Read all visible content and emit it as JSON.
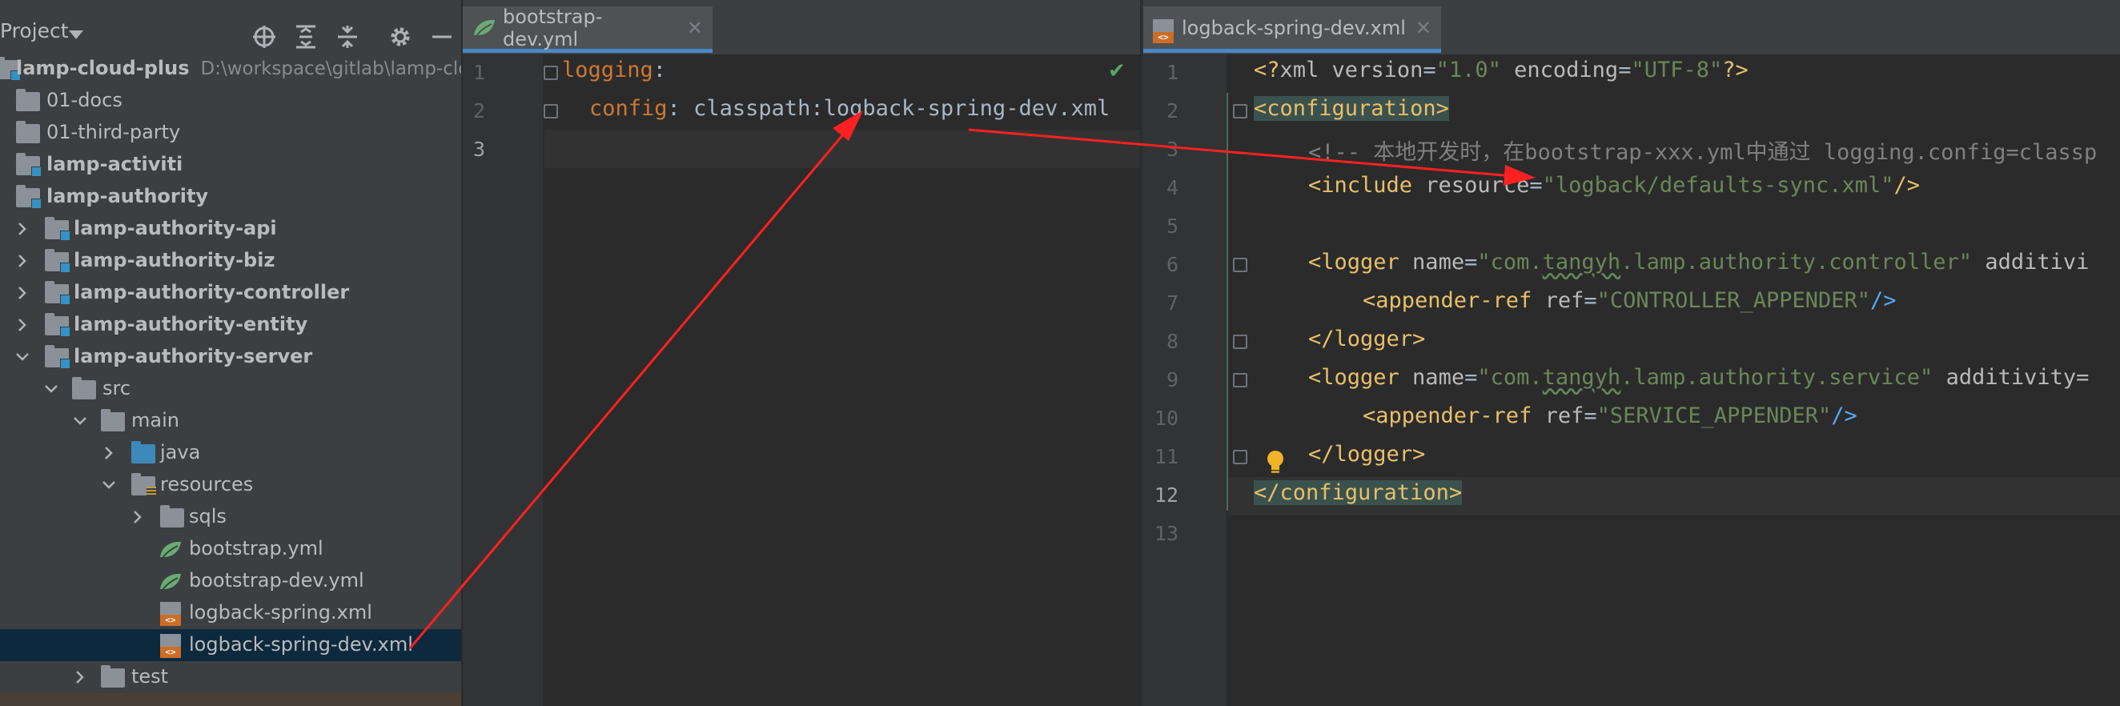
{
  "project": {
    "title": "Project",
    "root": {
      "name": "lamp-cloud-plus",
      "path": "D:\\workspace\\gitlab\\lamp-clou"
    },
    "items": [
      {
        "label": "01-docs"
      },
      {
        "label": "01-third-party"
      },
      {
        "label": "lamp-activiti"
      },
      {
        "label": "lamp-authority"
      },
      {
        "label": "lamp-authority-api"
      },
      {
        "label": "lamp-authority-biz"
      },
      {
        "label": "lamp-authority-controller"
      },
      {
        "label": "lamp-authority-entity"
      },
      {
        "label": "lamp-authority-server"
      },
      {
        "label": "src"
      },
      {
        "label": "main"
      },
      {
        "label": "java"
      },
      {
        "label": "resources"
      },
      {
        "label": "sqls"
      },
      {
        "label": "bootstrap.yml"
      },
      {
        "label": "bootstrap-dev.yml"
      },
      {
        "label": "logback-spring.xml"
      },
      {
        "label": "logback-spring-dev.xml"
      },
      {
        "label": "test"
      }
    ]
  },
  "editor_left": {
    "tab": "bootstrap-dev.yml",
    "line_numbers": [
      "1",
      "2",
      "3"
    ],
    "line1_key": "logging",
    "line1_colon": ":",
    "line2_key": "config",
    "line2_sep": ": ",
    "line2_value": "classpath:logback-spring-dev.xml"
  },
  "editor_right": {
    "tab": "logback-spring-dev.xml",
    "line_numbers": [
      "1",
      "2",
      "3",
      "4",
      "5",
      "6",
      "7",
      "8",
      "9",
      "10",
      "11",
      "12",
      "13"
    ],
    "l1": {
      "open": "<?",
      "name": "xml",
      "a1": " version",
      "eq1": "=",
      "v1": "\"1.0\"",
      "a2": " encoding",
      "eq2": "=",
      "v2": "\"UTF-8\"",
      "close": "?>"
    },
    "l2": "<configuration>",
    "l3": "<!-- 本地开发时，在bootstrap-xxx.yml中通过 logging.config=classp",
    "l4": {
      "open": "<include",
      "attr": " resource",
      "eq": "=",
      "val": "\"logback/defaults-sync.xml\"",
      "close": "/>"
    },
    "l6": {
      "open": "<logger",
      "attr": " name",
      "eq": "=",
      "val_pre": "\"com.",
      "val_wavy": "tangyh",
      "val_post": ".lamp.authority.controller\"",
      "rest": " additivi"
    },
    "l7": {
      "open": "<appender-ref",
      "attr": " ref",
      "eq": "=",
      "val": "\"CONTROLLER_APPENDER\"",
      "close": "/>"
    },
    "l8": "</logger>",
    "l9": {
      "open": "<logger",
      "attr": " name",
      "eq": "=",
      "val_pre": "\"com.",
      "val_wavy": "tangyh",
      "val_post": ".lamp.authority.service\"",
      "rest": " additivity="
    },
    "l10": {
      "open": "<appender-ref",
      "attr": " ref",
      "eq": "=",
      "val": "\"SERVICE_APPENDER\"",
      "close": "/>"
    },
    "l11": "</logger>",
    "l12": "</configuration>"
  },
  "icons": {
    "locate": "crosshair-icon",
    "expand": "expand-all-icon",
    "collapse": "collapse-all-icon",
    "settings": "gear-icon",
    "hide": "minimize-icon",
    "close": "close-icon",
    "check": "check-icon",
    "bulb": "lightbulb-icon"
  },
  "colors": {
    "annotation_arrow": "#ff2020",
    "selection": "#0d293e",
    "accent": "#4a88c7"
  }
}
